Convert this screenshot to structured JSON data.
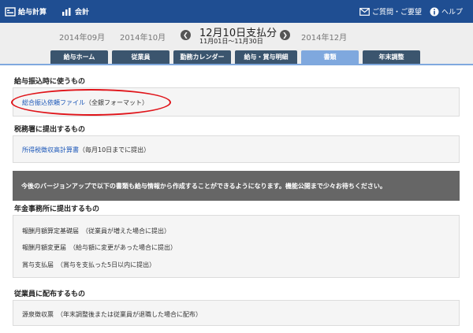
{
  "topnav": {
    "payroll": "給与計算",
    "accounting": "会計",
    "contact": "ご質問・ご要望",
    "help": "ヘルプ"
  },
  "period": {
    "prev_prev": "2014年09月",
    "prev": "2014年10月",
    "current_title": "12月10日支払分",
    "current_range": "11月01日〜11月30日",
    "next": "2014年12月"
  },
  "tabs": [
    "給与ホーム",
    "従業員",
    "勤務カレンダー",
    "給与・賞与明細",
    "書類",
    "年末調整"
  ],
  "sections": {
    "bank_title": "給与振込時に使うもの",
    "bank_link": "総合振込依頼ファイル",
    "bank_note": "（全銀フォーマット）",
    "tax_title": "税務署に提出するもの",
    "tax_link": "所得税徴収高計算書",
    "tax_note": "（毎月10日までに提出）",
    "banner": "今後のバージョンアップで以下の書類も給与情報から作成することができるようになります。機能公開まで少々お待ちください。",
    "pension_title": "年金事務所に提出するもの",
    "pension_item1": "報酬月額算定基礎届　（従業員が増えた場合に提出）",
    "pension_item2": "報酬月額変更届　（給与額に変更があった場合に提出）",
    "pension_item3": "賞与支払届　（賞与を支払った5日以内に提出）",
    "employee_title": "従業員に配布するもの",
    "employee_item1": "源泉徴収票　（年末調整後または従業員が退職した場合に配布）"
  },
  "colors": {
    "topbar": "#1f4e92",
    "tab": "#3b556e",
    "tab_active": "#7fa8de",
    "link": "#1a56b8",
    "highlight": "#e0141a"
  }
}
